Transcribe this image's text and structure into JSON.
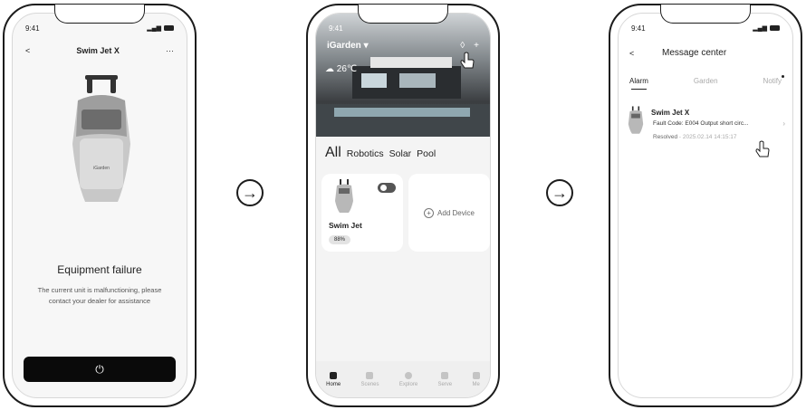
{
  "phone1": {
    "status_time": "9:41",
    "title": "Swim Jet X",
    "back": "<",
    "more": "···",
    "device_brand": "iGarden",
    "error_title": "Equipment failure",
    "error_desc": "The current unit is malfunctioning, please contact your dealer for assistance",
    "power_icon": "⏻"
  },
  "arrows": {
    "icon": "→"
  },
  "phone2": {
    "status_time": "9:41",
    "home_name": "iGarden",
    "weather": "26℃",
    "categories": [
      "All",
      "Robotics",
      "Solar",
      "Pool"
    ],
    "device": {
      "name": "Swim Jet",
      "battery": "88%"
    },
    "add_device": "Add Device",
    "tabs": [
      "Home",
      "Scenes",
      "Explore",
      "Serve",
      "Me"
    ]
  },
  "phone3": {
    "status_time": "9:41",
    "back": "<",
    "title": "Message center",
    "tabs": [
      "Alarm",
      "Garden",
      "Notify"
    ],
    "message": {
      "name": "Swim Jet X",
      "fault": "Fault Code: E004 Output short circ...",
      "status": "Resolved",
      "time": "2025.02.14 14:15:17"
    }
  },
  "colors": {
    "button": "#0a0a0a",
    "accent": "#222222"
  }
}
